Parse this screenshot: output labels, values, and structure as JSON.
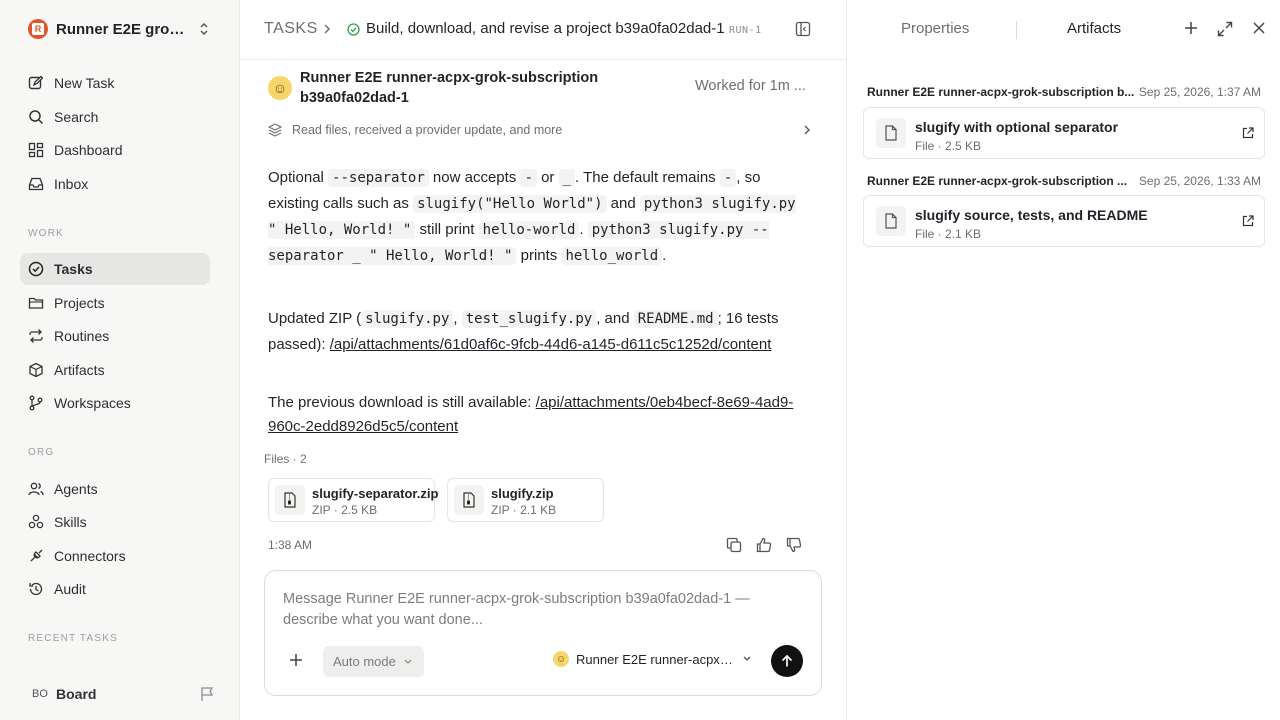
{
  "sidebar": {
    "workspace_name": "Runner E2E grok-...",
    "workspace_initial": "R",
    "primary_items": [
      {
        "label": "New Task",
        "icon": "edit-icon"
      },
      {
        "label": "Search",
        "icon": "search-icon"
      },
      {
        "label": "Dashboard",
        "icon": "dashboard-icon"
      },
      {
        "label": "Inbox",
        "icon": "inbox-icon"
      }
    ],
    "work_label": "WORK",
    "work_items": [
      {
        "label": "Tasks",
        "icon": "check-circle-icon",
        "active": true
      },
      {
        "label": "Projects",
        "icon": "folder-icon"
      },
      {
        "label": "Routines",
        "icon": "repeat-icon"
      },
      {
        "label": "Artifacts",
        "icon": "cube-icon"
      },
      {
        "label": "Workspaces",
        "icon": "git-branch-icon"
      }
    ],
    "org_label": "ORG",
    "org_items": [
      {
        "label": "Agents",
        "icon": "users-icon"
      },
      {
        "label": "Skills",
        "icon": "skills-icon"
      },
      {
        "label": "Connectors",
        "icon": "plug-icon"
      },
      {
        "label": "Audit",
        "icon": "history-icon"
      }
    ],
    "recent_label": "RECENT TASKS",
    "footer": {
      "initials": "BO",
      "name": "Board"
    }
  },
  "header": {
    "crumb_root": "TASKS",
    "title": "Build, download, and revise a project b39a0fa02dad-1",
    "run_badge": "RUN-1"
  },
  "agent": {
    "name": "Runner E2E runner-acpx-grok-subscription b39a0fa02dad-1",
    "worked": "Worked for 1m ...",
    "activity_summary": "Read files, received a provider update, and more"
  },
  "message": {
    "p1": {
      "t1": "Optional ",
      "c1": "--separator",
      "t2": " now accepts ",
      "c2": "-",
      "t3": " or ",
      "c3": "_",
      "t4": ". The default remains ",
      "c4": "-",
      "t5": ", so existing calls such as ",
      "c5": "slugify(\"Hello World\")",
      "t6": " and ",
      "c6": "python3 slugify.py \" Hello, World! \"",
      "t7": " still print ",
      "c7": "hello-world",
      "t8": ". ",
      "c8": "python3 slugify.py --separator _ \" Hello, World! \"",
      "t9": " prints ",
      "c9": "hello_world",
      "t10": "."
    },
    "p2": {
      "t1": "Updated ZIP (",
      "c1": "slugify.py",
      "t2": ", ",
      "c2": "test_slugify.py",
      "t3": ", and ",
      "c3": "README.md",
      "t4": "; 16 tests passed): ",
      "link": "/api/attachments/61d0af6c-9fcb-44d6-a145-d611c5c1252d/content"
    },
    "p3": {
      "t1": "The previous download is still available: ",
      "link": "/api/attachments/0eb4becf-8e69-4ad9-960c-2edd8926d5c5/content"
    },
    "files_label": "Files · 2",
    "files": [
      {
        "name": "slugify-separator.zip",
        "meta": "ZIP · 2.5 KB"
      },
      {
        "name": "slugify.zip",
        "meta": "ZIP · 2.1 KB"
      }
    ],
    "time": "1:38 AM"
  },
  "composer": {
    "placeholder": "Message Runner E2E runner-acpx-grok-subscription b39a0fa02dad-1 — describe what you want done...",
    "mode": "Auto mode",
    "agent": "Runner E2E runner-acpx-..."
  },
  "panel": {
    "tab_properties": "Properties",
    "tab_artifacts": "Artifacts",
    "artifacts": [
      {
        "source": "Runner E2E runner-acpx-grok-subscription b...",
        "date": "Sep 25, 2026, 1:37 AM",
        "title": "slugify with optional separator",
        "meta": "File · 2.5 KB"
      },
      {
        "source": "Runner E2E runner-acpx-grok-subscription ...",
        "date": "Sep 25, 2026, 1:33 AM",
        "title": "slugify source, tests, and README",
        "meta": "File · 2.1 KB"
      }
    ]
  },
  "colors": {
    "brand": "#e0552a",
    "active_nav": "#e6e6e4",
    "success": "#2da44e",
    "send_button": "#111111"
  }
}
